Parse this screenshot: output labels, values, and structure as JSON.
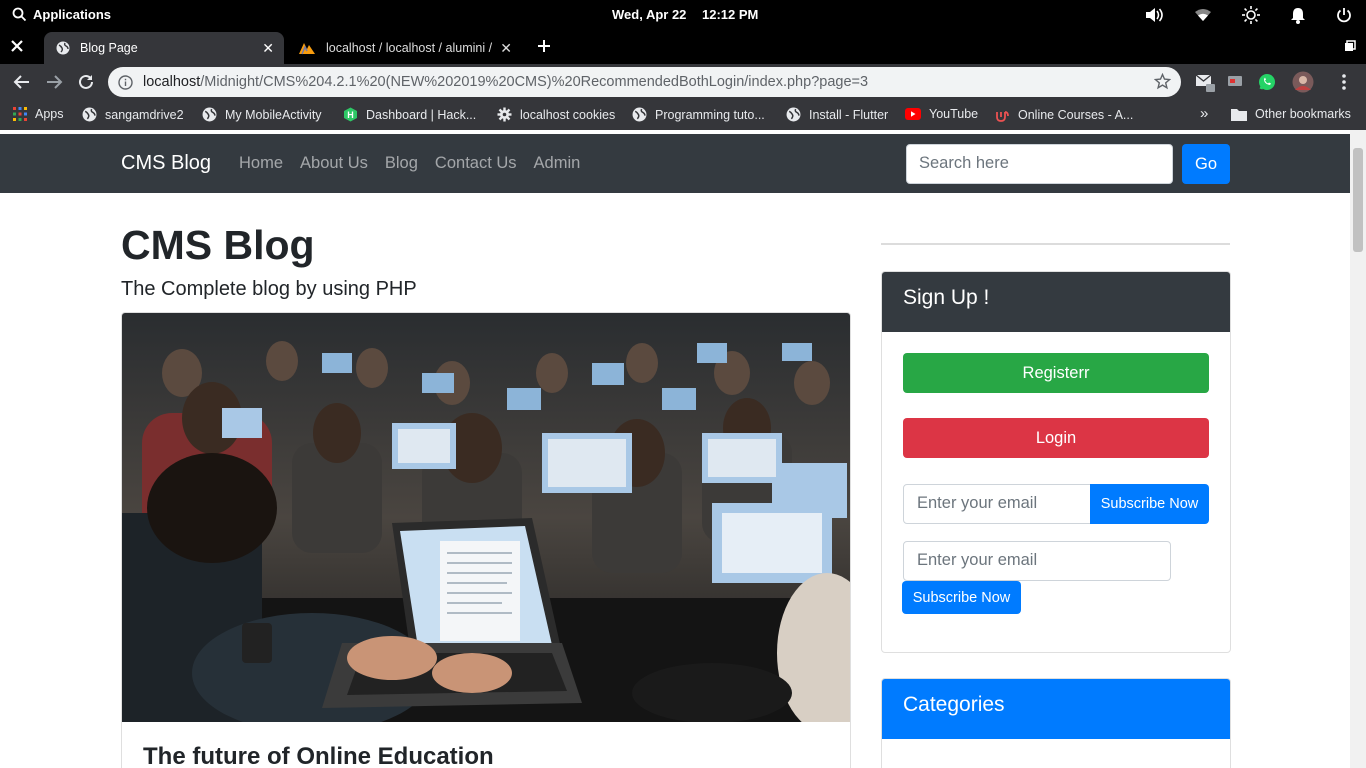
{
  "os": {
    "applications_label": "Applications",
    "date": "Wed, Apr 22",
    "time": "12:12 PM"
  },
  "tabs": [
    {
      "title": "Blog Page",
      "active": true
    },
    {
      "title": "localhost / localhost / alumini / ",
      "active": false
    }
  ],
  "omnibox": {
    "host": "localhost",
    "path": "/Midnight/CMS%204.2.1%20(NEW%202019%20CMS)%20RecommendedBothLogin/index.php?page=3"
  },
  "bookmarks": {
    "items": [
      {
        "label": "Apps",
        "icon": "apps-grid-icon"
      },
      {
        "label": "sangamdrive2",
        "icon": "globe-icon"
      },
      {
        "label": "My MobileActivity",
        "icon": "globe-icon"
      },
      {
        "label": "Dashboard | Hack...",
        "icon": "hackerrank-icon"
      },
      {
        "label": "localhost cookies",
        "icon": "gear-icon"
      },
      {
        "label": "Programming tuto...",
        "icon": "globe-icon"
      },
      {
        "label": "Install - Flutter",
        "icon": "globe-icon"
      },
      {
        "label": "YouTube",
        "icon": "youtube-icon"
      },
      {
        "label": "Online Courses - A...",
        "icon": "udemy-icon"
      }
    ],
    "overflow": "»",
    "other": "Other bookmarks"
  },
  "navbar": {
    "brand": "CMS Blog",
    "links": [
      "Home",
      "About Us",
      "Blog",
      "Contact Us",
      "Admin"
    ],
    "search_placeholder": "Search here",
    "go_label": "Go"
  },
  "main": {
    "heading": "CMS Blog",
    "subheading": "The Complete blog by using PHP",
    "post_title": "The future of Online Education"
  },
  "sidebar": {
    "signup_title": "Sign Up !",
    "register_label": "Registerr",
    "login_label": "Login",
    "email_placeholder_1": "Enter your email",
    "subscribe_label_1": "Subscribe Now",
    "email_placeholder_2": "Enter your email",
    "subscribe_label_2": "Subscribe Now",
    "categories_title": "Categories"
  },
  "colors": {
    "navbar_bg": "#343a40",
    "primary": "#007bff",
    "success": "#28a745",
    "danger": "#dc3545"
  }
}
